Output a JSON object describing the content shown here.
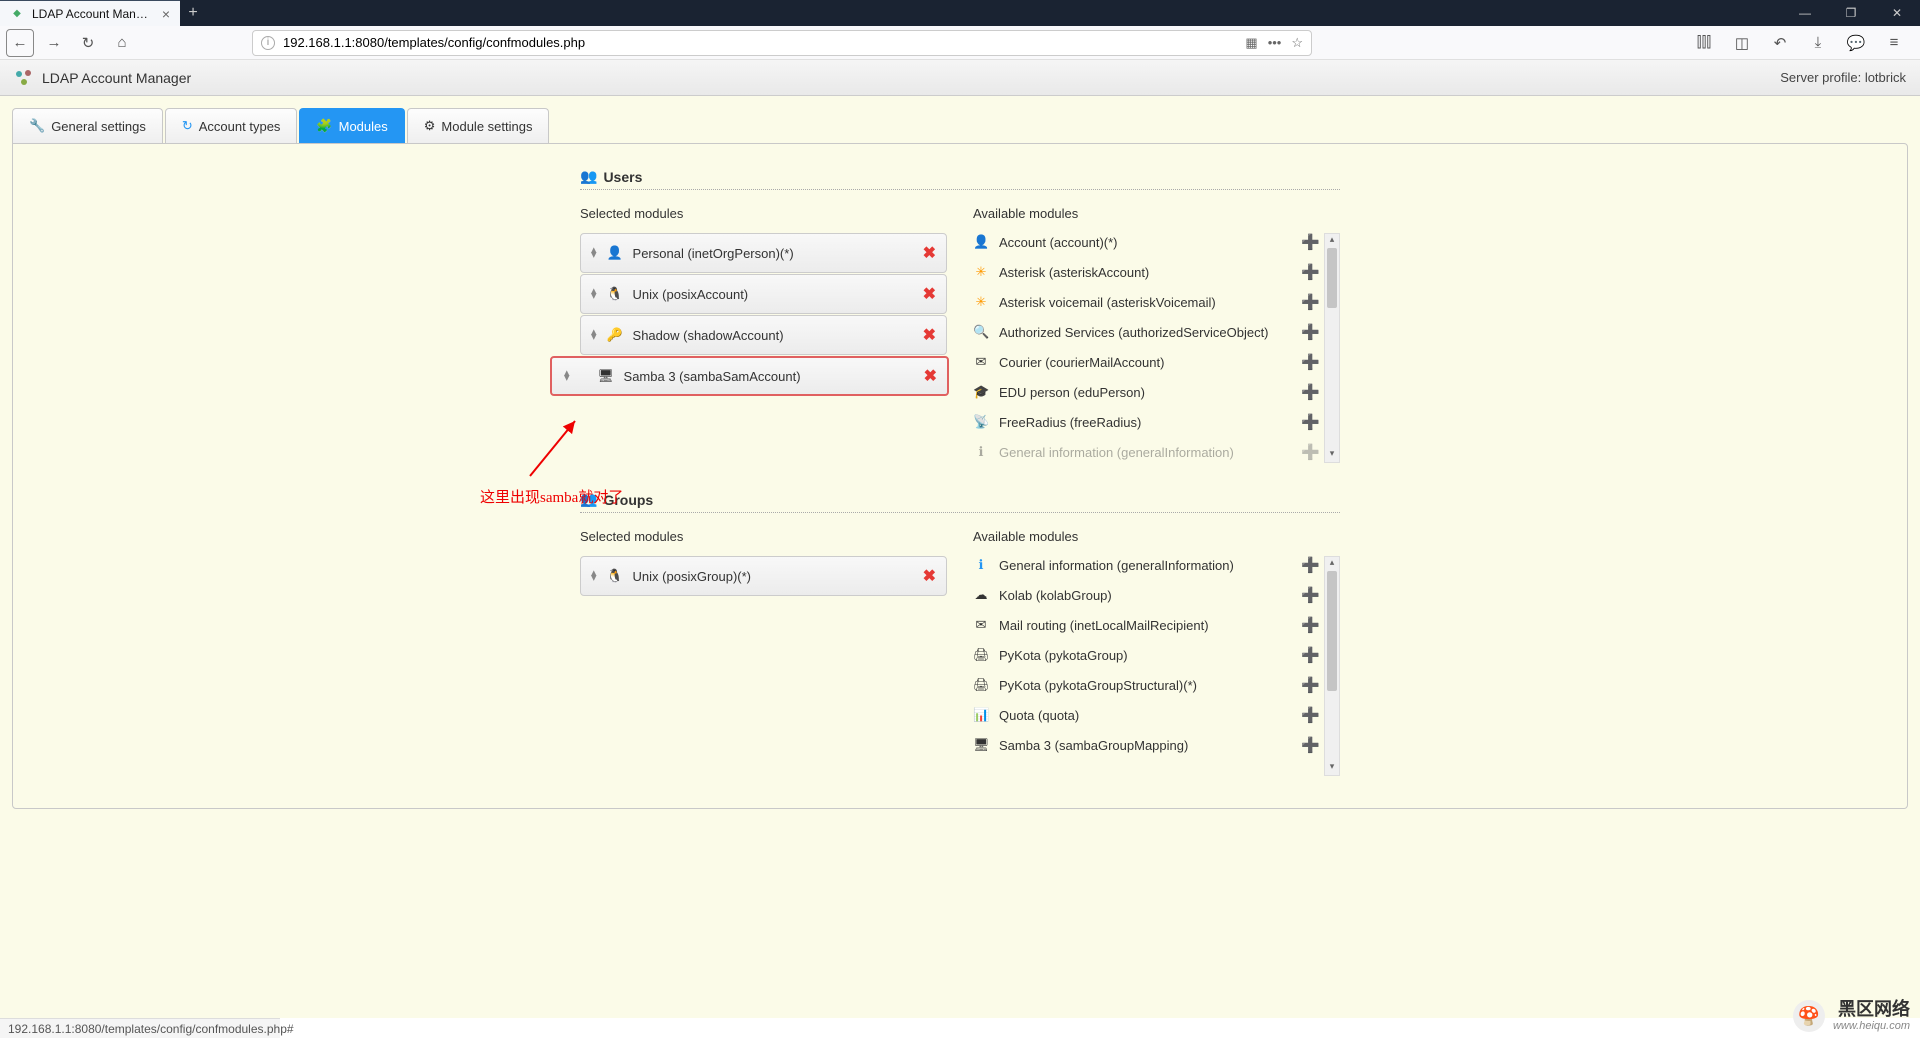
{
  "browser": {
    "tab_title": "LDAP Account Manager Con",
    "url": "192.168.1.1:8080/templates/config/confmodules.php",
    "status_text": "192.168.1.1:8080/templates/config/confmodules.php#"
  },
  "app": {
    "title": "LDAP Account Manager",
    "server_profile_label": "Server profile:",
    "server_profile_value": "lotbrick"
  },
  "tabs": {
    "general": "General settings",
    "account_types": "Account types",
    "modules": "Modules",
    "module_settings": "Module settings"
  },
  "labels": {
    "selected_modules": "Selected modules",
    "available_modules": "Available modules"
  },
  "users": {
    "title": "Users",
    "selected": [
      {
        "label": "Personal (inetOrgPerson)(*)",
        "icon": "👤"
      },
      {
        "label": "Unix (posixAccount)",
        "icon": "🐧"
      },
      {
        "label": "Shadow (shadowAccount)",
        "icon": "🔑"
      },
      {
        "label": "Samba 3 (sambaSamAccount)",
        "icon": "🖥"
      }
    ],
    "available": [
      {
        "label": "Account (account)(*)",
        "icon": "👤"
      },
      {
        "label": "Asterisk (asteriskAccount)",
        "icon": "✳"
      },
      {
        "label": "Asterisk voicemail (asteriskVoicemail)",
        "icon": "✳"
      },
      {
        "label": "Authorized Services (authorizedServiceObject)",
        "icon": "🔍"
      },
      {
        "label": "Courier (courierMailAccount)",
        "icon": "✉"
      },
      {
        "label": "EDU person (eduPerson)",
        "icon": "🎓"
      },
      {
        "label": "FreeRadius (freeRadius)",
        "icon": "📡"
      },
      {
        "label": "General information (generalInformation)",
        "icon": "ℹ"
      }
    ]
  },
  "groups": {
    "title": "Groups",
    "selected": [
      {
        "label": "Unix (posixGroup)(*)",
        "icon": "🐧"
      }
    ],
    "available": [
      {
        "label": "General information (generalInformation)",
        "icon": "ℹ"
      },
      {
        "label": "Kolab (kolabGroup)",
        "icon": "☁"
      },
      {
        "label": "Mail routing (inetLocalMailRecipient)",
        "icon": "✉"
      },
      {
        "label": "PyKota (pykotaGroup)",
        "icon": "🖨"
      },
      {
        "label": "PyKota (pykotaGroupStructural)(*)",
        "icon": "🖨"
      },
      {
        "label": "Quota (quota)",
        "icon": "📊"
      },
      {
        "label": "Samba 3 (sambaGroupMapping)",
        "icon": "🖥"
      }
    ]
  },
  "annotation": {
    "text": "这里出现samba就对了"
  },
  "watermark": {
    "title": "黑区网络",
    "url": "www.heiqu.com"
  }
}
